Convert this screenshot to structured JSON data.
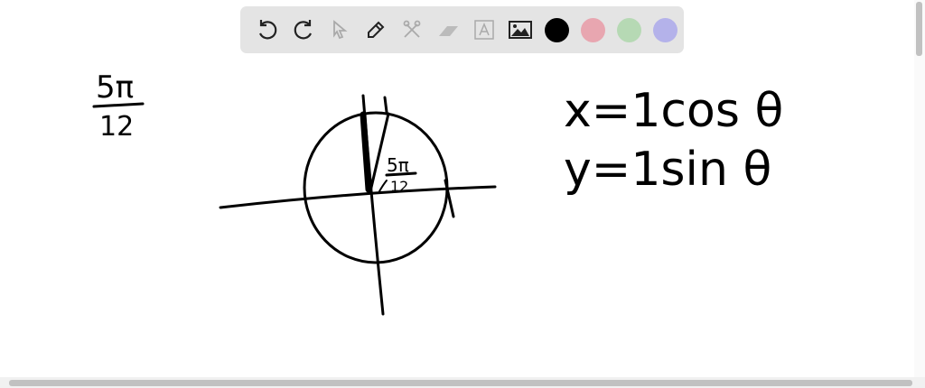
{
  "toolbar": {
    "tools": [
      "undo-icon",
      "redo-icon",
      "select-icon",
      "pen-icon",
      "tools-icon",
      "eraser-icon",
      "text-icon",
      "image-icon"
    ],
    "colors": [
      "#000000",
      "#e8a6b0",
      "#b6d9b4",
      "#b4b2ea"
    ]
  },
  "canvas": {
    "left_label_num": "5π",
    "left_label_den": "12",
    "angle_num": "5π",
    "angle_den": "12",
    "eq_x": "x=1cos θ",
    "eq_y": "y=1sin θ"
  }
}
